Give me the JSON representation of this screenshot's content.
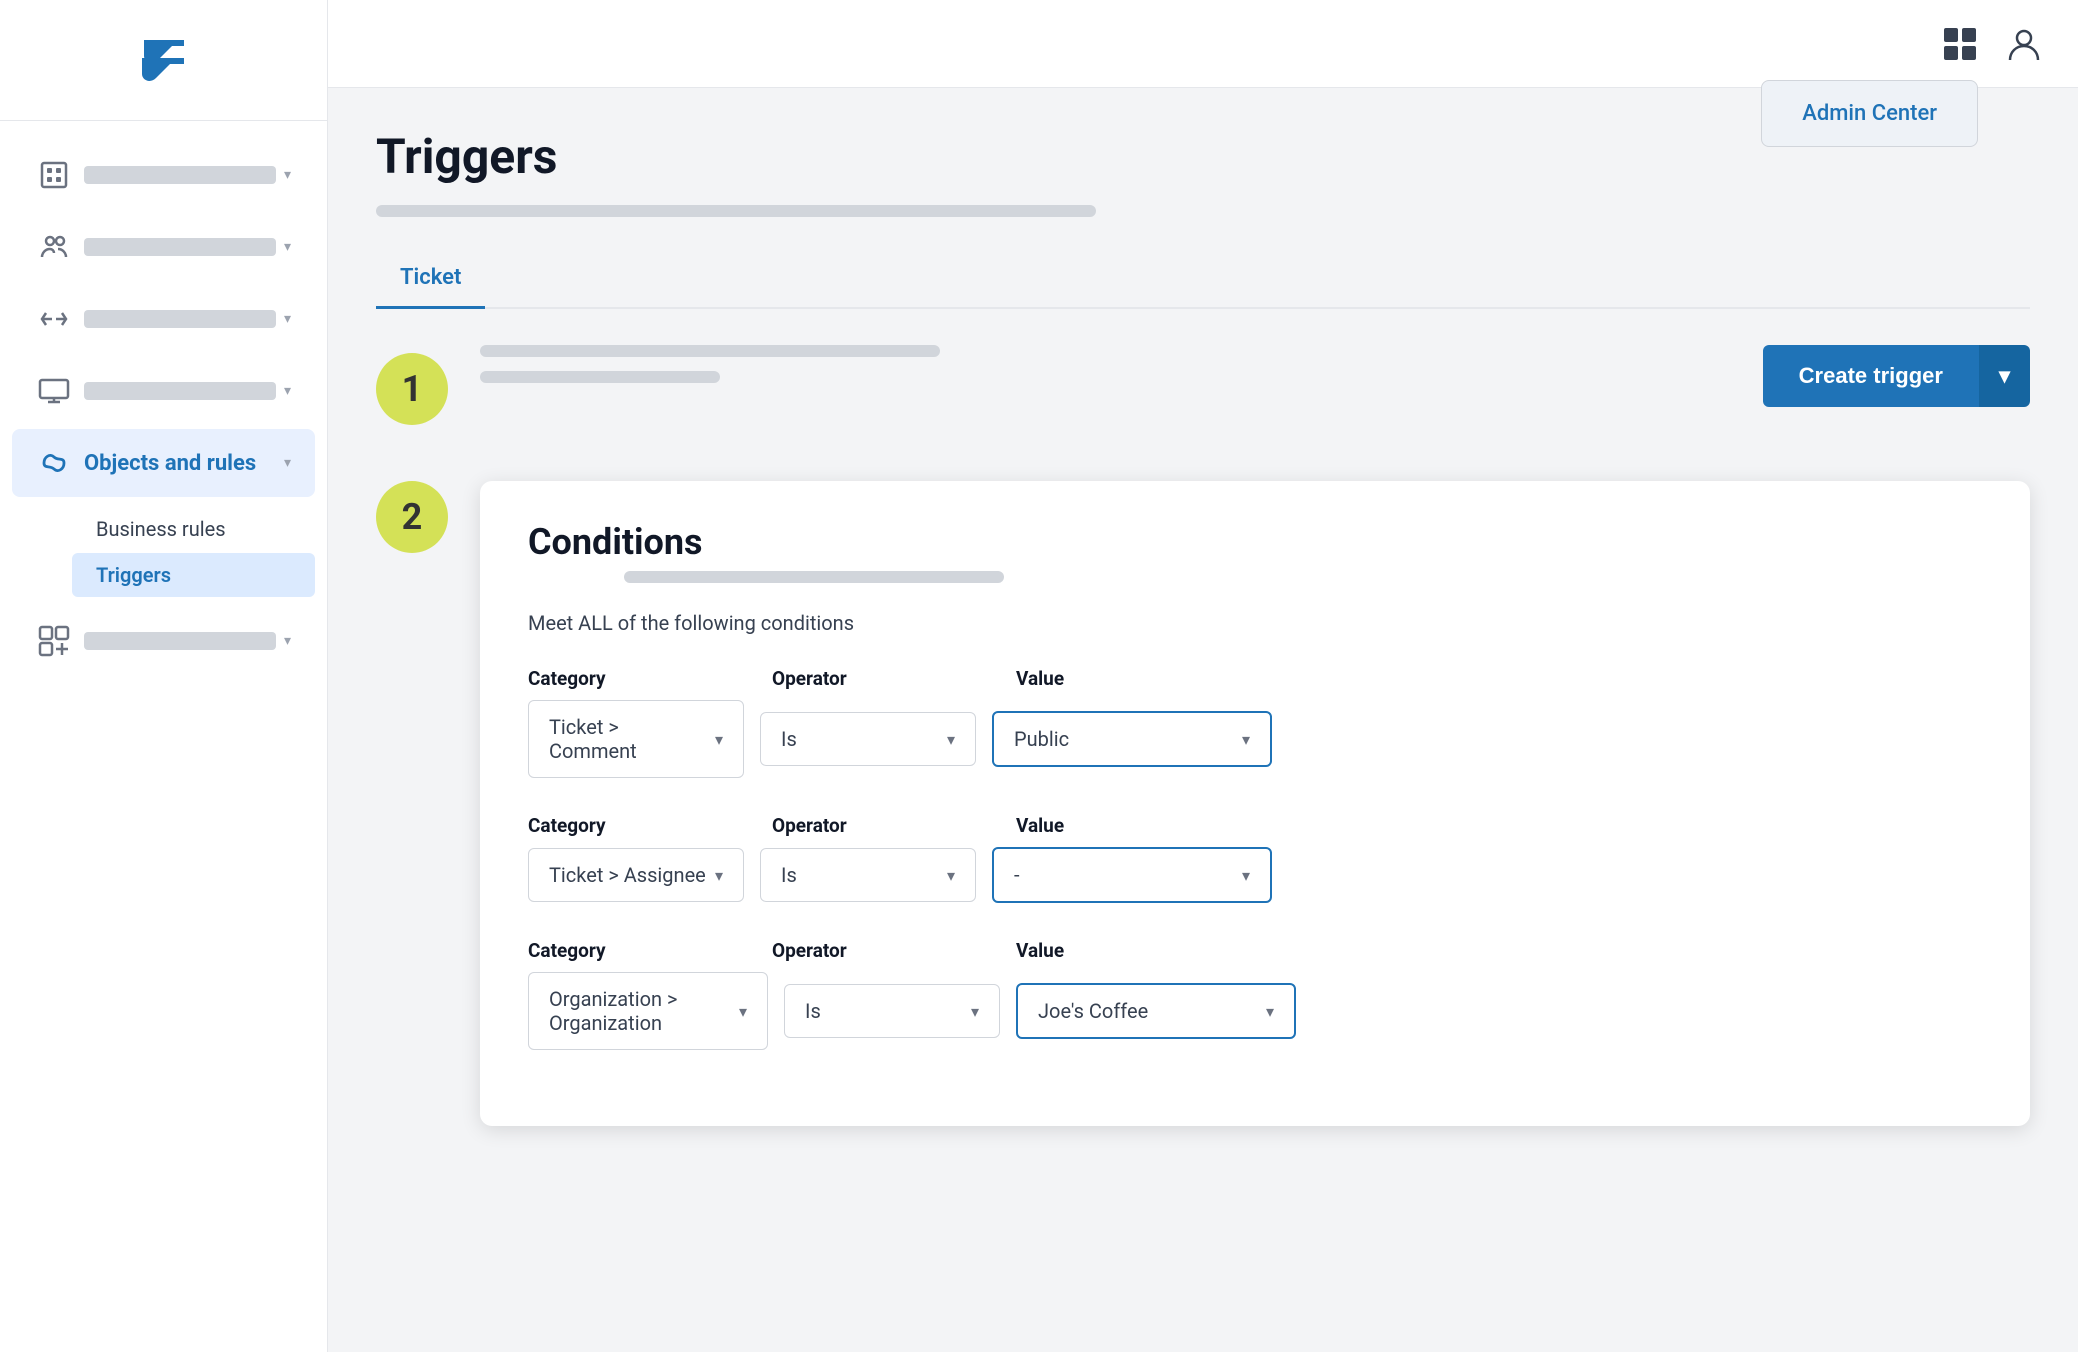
{
  "sidebar": {
    "nav_items": [
      {
        "id": "workspace",
        "icon": "building-icon",
        "active": false
      },
      {
        "id": "people",
        "icon": "people-icon",
        "active": false
      },
      {
        "id": "channels",
        "icon": "channels-icon",
        "active": false
      },
      {
        "id": "display",
        "icon": "display-icon",
        "active": false
      },
      {
        "id": "objects-rules",
        "icon": "objects-rules-icon",
        "label": "Objects and rules",
        "active": true
      },
      {
        "id": "apps",
        "icon": "apps-icon",
        "active": false
      }
    ],
    "sub_nav": {
      "parent": "Objects and rules",
      "sections": [
        {
          "id": "business-rules",
          "label": "Business rules",
          "active": false
        },
        {
          "id": "triggers",
          "label": "Triggers",
          "active": true
        }
      ]
    }
  },
  "topbar": {
    "apps_icon": "grid-icon",
    "profile_icon": "profile-icon",
    "admin_dropdown": {
      "visible": true,
      "label": "Admin Center"
    }
  },
  "main": {
    "page_title": "Triggers",
    "tabs": [
      {
        "id": "ticket",
        "label": "Ticket",
        "active": true
      }
    ],
    "create_trigger_button": "Create trigger",
    "dropdown_button": "▾",
    "step1_badge": "1",
    "step2_badge": "2"
  },
  "conditions": {
    "title": "Conditions",
    "description": "Meet ALL of the following conditions",
    "rows": [
      {
        "category_label": "Category",
        "category_value": "Ticket > Comment",
        "operator_label": "Operator",
        "operator_value": "Is",
        "value_label": "Value",
        "value_value": "Public"
      },
      {
        "category_label": "Category",
        "category_value": "Ticket > Assignee",
        "operator_label": "Operator",
        "operator_value": "Is",
        "value_label": "Value",
        "value_value": "-"
      },
      {
        "category_label": "Category",
        "category_value": "Organization > Organization",
        "operator_label": "Operator",
        "operator_value": "Is",
        "value_label": "Value",
        "value_value": "Joe's Coffee"
      }
    ]
  }
}
